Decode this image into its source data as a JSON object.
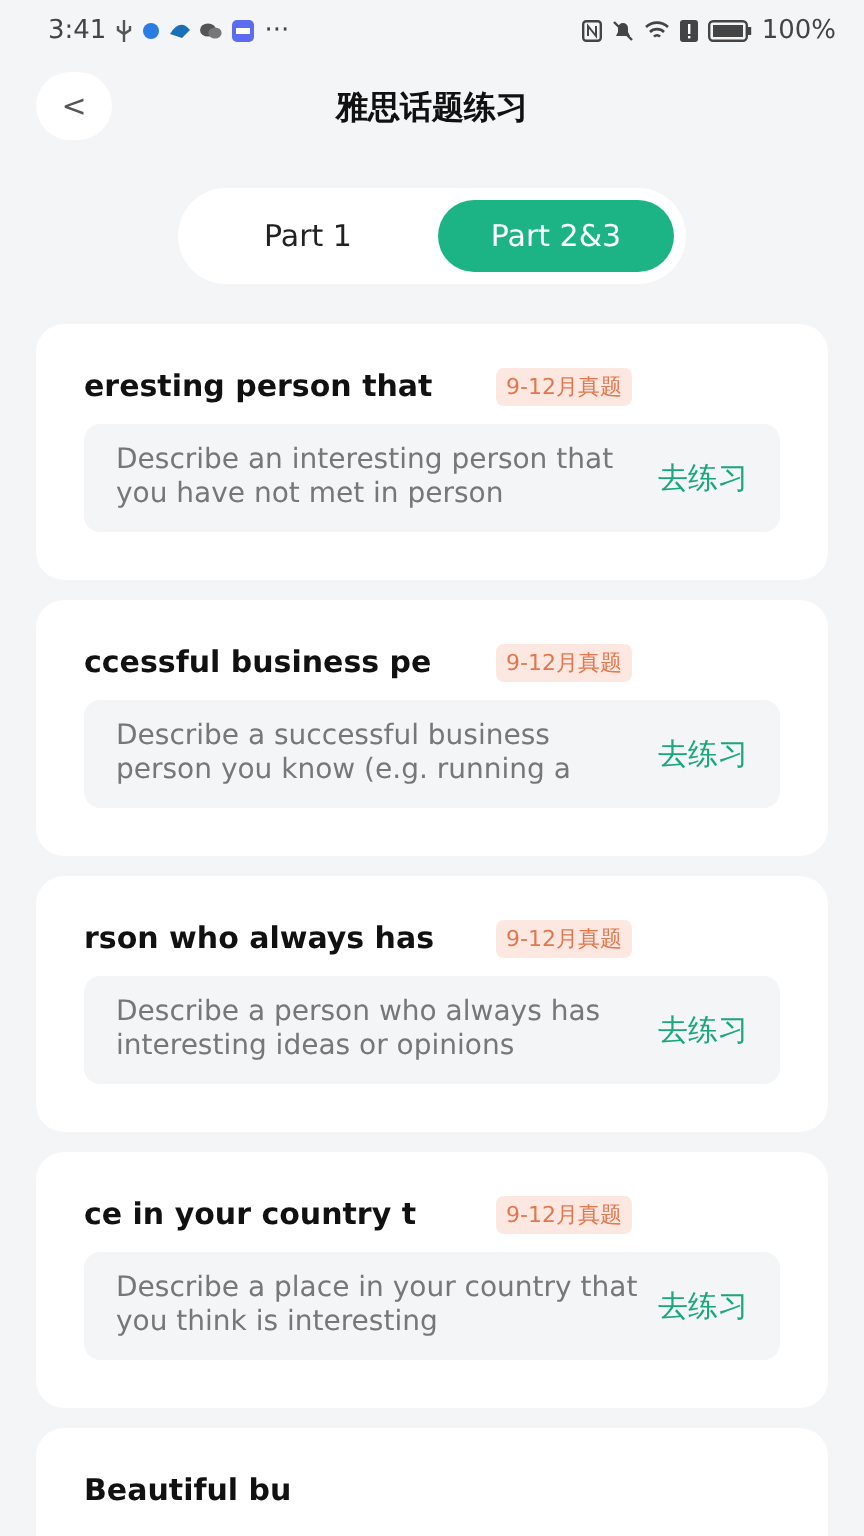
{
  "status_bar": {
    "time": "3:41",
    "more": "···",
    "battery": "100%"
  },
  "header": {
    "back": "<",
    "title": "雅思话题练习"
  },
  "tabs": [
    {
      "label": "Part 1",
      "selected": false
    },
    {
      "label": "Part 2&3",
      "selected": true
    }
  ],
  "topics": [
    {
      "title": "eresting person that",
      "badge": "9-12月真题",
      "description": "Describe an interesting person that you have not met in person",
      "action": "去练习"
    },
    {
      "title": "ccessful business pe",
      "badge": "9-12月真题",
      "description": "Describe a successful business person you know (e.g. running a",
      "action": "去练习"
    },
    {
      "title": "rson who always has",
      "badge": "9-12月真题",
      "description": "Describe a person who always has interesting ideas or opinions",
      "action": "去练习"
    },
    {
      "title": "ce in your country t",
      "badge": "9-12月真题",
      "description": "Describe a place in your country that you think is interesting",
      "action": "去练习"
    },
    {
      "title": "Beautiful bu"
    }
  ]
}
